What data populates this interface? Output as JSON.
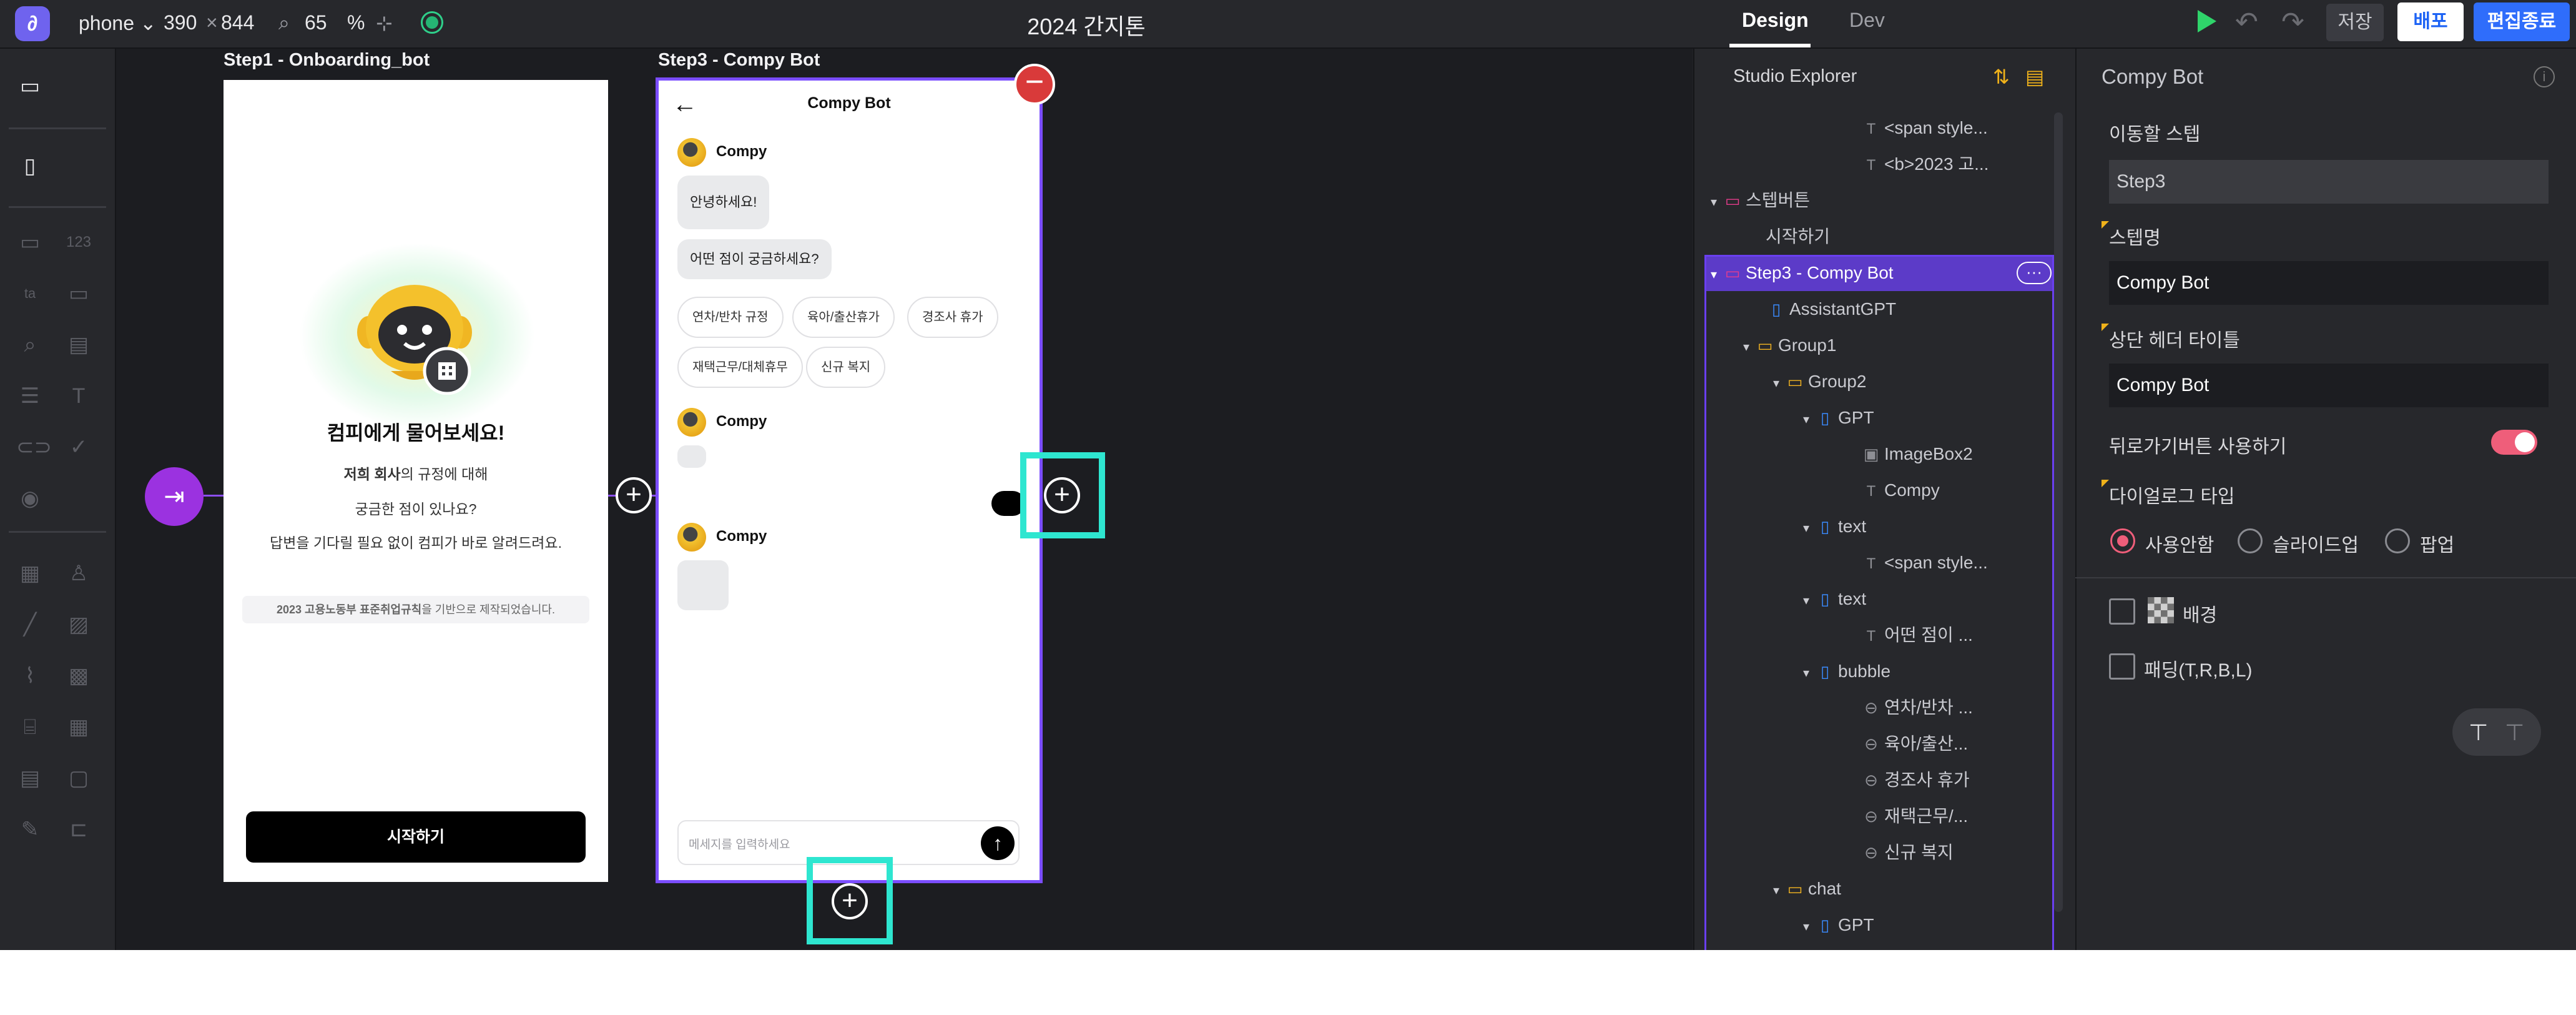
{
  "topbar": {
    "logo": "∂",
    "device": "phone",
    "width": "390",
    "times": "×",
    "height": "844",
    "zoom": "65",
    "zoom_unit": "%",
    "doc_title": "2024 간지톤"
  },
  "canvas": {
    "frame1": {
      "label": "Step1 - Onboarding_bot",
      "title": "컴피에게 물어보세요!",
      "line1_bold": "저희 회사",
      "line1_rest": "의 규정에 대해",
      "line2": "궁금한 점이 있나요?",
      "line3": "답변을 기다릴 필요 없이 컴피가 바로 알려드려요.",
      "note_bold": "2023 고용노동부 표준취업규칙",
      "note_rest": "을 기반으로 제작되었습니다.",
      "start_button": "시작하기"
    },
    "frame3": {
      "label": "Step3 - Compy Bot",
      "header_title": "Compy Bot",
      "back_arrow": "←",
      "bot_name": "Compy",
      "bubble1": "안녕하세요!",
      "bubble2": "어떤 점이 궁금하세요?",
      "chips": [
        "연차/반차 규정",
        "육아/출산휴가",
        "경조사 휴가",
        "재택근무/대체휴무",
        "신규 복지"
      ],
      "input_placeholder": "메세지를 입력하세요",
      "send_icon": "↑"
    },
    "delete_badge": "−",
    "plus": "+"
  },
  "right_top": {
    "tab_design": "Design",
    "tab_dev": "Dev",
    "undo": "↶",
    "redo": "↷",
    "save": "저장",
    "deploy": "배포",
    "end_edit": "편집종료"
  },
  "explorer": {
    "title": "Studio Explorer",
    "rows": [
      {
        "text": "<span style...",
        "icon": "T"
      },
      {
        "text": "<b>2023 고...",
        "icon": "T"
      },
      {
        "text": "스텝버튼",
        "icon": "▭"
      },
      {
        "text": "시작하기",
        "icon": ""
      },
      {
        "text": "Step3 - Compy Bot",
        "icon": "▭"
      },
      {
        "text": "AssistantGPT",
        "icon": "▯"
      },
      {
        "text": "Group1",
        "icon": "▭"
      },
      {
        "text": "Group2",
        "icon": "▭"
      },
      {
        "text": "GPT",
        "icon": "▯"
      },
      {
        "text": "ImageBox2",
        "icon": "▣"
      },
      {
        "text": "Compy",
        "icon": "T"
      },
      {
        "text": "text",
        "icon": "▯"
      },
      {
        "text": "<span style...",
        "icon": "T"
      },
      {
        "text": "text",
        "icon": "▯"
      },
      {
        "text": "어떤 점이 ...",
        "icon": "T"
      },
      {
        "text": "bubble",
        "icon": "▯"
      },
      {
        "text": "연차/반차 ...",
        "icon": "⊖"
      },
      {
        "text": "육아/출산...",
        "icon": "⊖"
      },
      {
        "text": "경조사 휴가",
        "icon": "⊖"
      },
      {
        "text": "재택근무/...",
        "icon": "⊖"
      },
      {
        "text": "신규 복지",
        "icon": "⊖"
      },
      {
        "text": "chat",
        "icon": "▭"
      },
      {
        "text": "GPT",
        "icon": "▯"
      }
    ],
    "more": "···"
  },
  "props": {
    "title": "Compy Bot",
    "info": "i",
    "move_step_label": "이동할 스텝",
    "move_step_value": "Step3",
    "step_name_label": "스텝명",
    "step_name_value": "Compy Bot",
    "header_title_label": "상단 헤더 타이틀",
    "header_title_value": "Compy Bot",
    "back_button_label": "뒤로가기버튼 사용하기",
    "back_button_on": true,
    "dialog_type_label": "다이얼로그 타입",
    "dialog_options": [
      "사용안함",
      "슬라이드업",
      "팝업"
    ],
    "dialog_selected": "사용안함",
    "background_label": "배경",
    "padding_label": "패딩(T,R,B,L)"
  },
  "colors": {
    "accent": "#7b4dff",
    "highlight": "#2ee6d0",
    "primary_blue": "#2f6dfb",
    "toggle_pink": "#ef5e7a"
  }
}
